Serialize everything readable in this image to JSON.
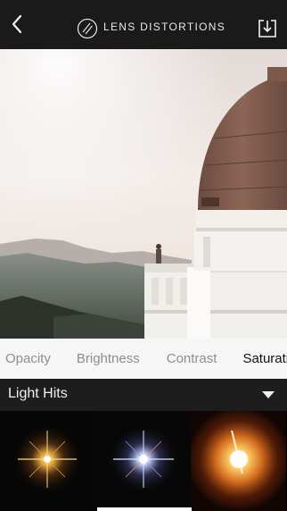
{
  "header": {
    "back_icon": "chevron-left-icon",
    "logo_icon": "lens-logo-icon",
    "app_title": "LENS DISTORTIONS",
    "download_icon": "download-icon"
  },
  "tabs": [
    {
      "label": "Opacity",
      "selected": false
    },
    {
      "label": "Brightness",
      "selected": false
    },
    {
      "label": "Contrast",
      "selected": false
    },
    {
      "label": "Saturation",
      "selected": true
    }
  ],
  "category": {
    "label": "Light Hits",
    "chevron_icon": "chevron-down-icon"
  },
  "presets": [
    {
      "name": "light-hit-1",
      "selected": false
    },
    {
      "name": "light-hit-2",
      "selected": true
    },
    {
      "name": "light-hit-3",
      "selected": false
    }
  ],
  "colors": {
    "header_bg": "#1a1a1a",
    "tabs_bg": "#f6f6f6",
    "tab_selected": "#111111",
    "tab_unselected": "#8d8d8d",
    "category_bg": "#1d1d1d"
  }
}
